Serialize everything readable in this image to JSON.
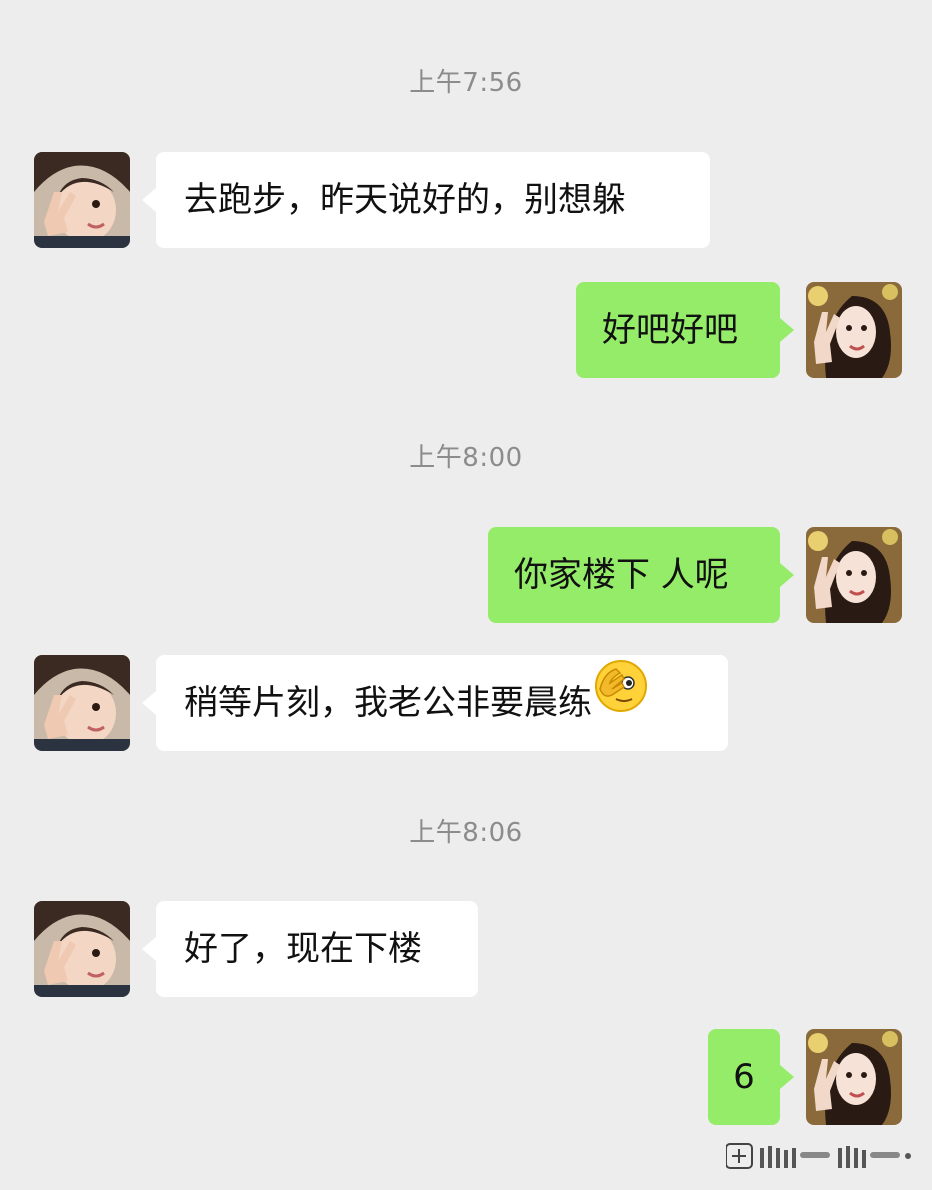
{
  "chat": {
    "messages": [
      {
        "type": "time",
        "text": "上午7:56"
      },
      {
        "type": "msg",
        "side": "in",
        "text": "去跑步，昨天说好的，别想躲"
      },
      {
        "type": "msg",
        "side": "out",
        "text": "好吧好吧"
      },
      {
        "type": "time",
        "text": "上午8:00"
      },
      {
        "type": "msg",
        "side": "out",
        "text": "你家楼下 人呢"
      },
      {
        "type": "msg",
        "side": "in",
        "text": "稍等片刻，我老公非要晨练",
        "emoji": "facepalm-peek-emoji"
      },
      {
        "type": "time",
        "text": "上午8:06"
      },
      {
        "type": "msg",
        "side": "in",
        "text": "好了，现在下楼"
      },
      {
        "type": "msg",
        "side": "out",
        "text": "6"
      }
    ]
  },
  "colors": {
    "background": "#ededed",
    "bubble_in": "#ffffff",
    "bubble_out": "#95ec69",
    "timestamp": "#8c8c8c"
  },
  "icons": {
    "avatar_in": "child-avatar",
    "avatar_out": "woman-avatar",
    "watermark": "platform-watermark"
  }
}
